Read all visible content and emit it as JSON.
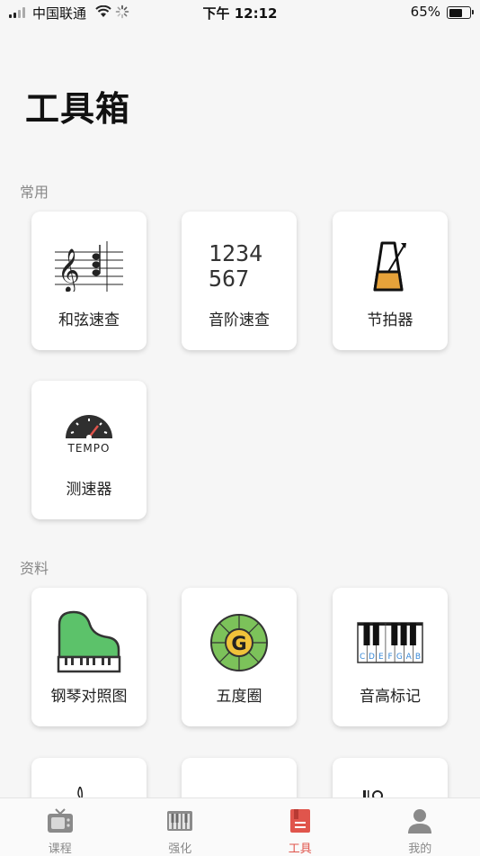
{
  "status_bar": {
    "carrier": "中国联通",
    "time": "下午 12:12",
    "battery_percent": "65%",
    "battery_level": 0.65
  },
  "page": {
    "title": "工具箱"
  },
  "sections": {
    "common": {
      "label": "常用",
      "items": [
        {
          "label": "和弦速查",
          "icon": "chord-staff-icon"
        },
        {
          "label": "音阶速查",
          "icon": "scale-numbers-icon",
          "icon_text_1": "1234",
          "icon_text_2": "567"
        },
        {
          "label": "节拍器",
          "icon": "metronome-icon"
        },
        {
          "label": "测速器",
          "icon": "tempo-meter-icon",
          "icon_text": "TEMPO"
        }
      ]
    },
    "reference": {
      "label": "资料",
      "items": [
        {
          "label": "钢琴对照图",
          "icon": "grand-piano-icon"
        },
        {
          "label": "五度圈",
          "icon": "circle-of-fifths-icon",
          "icon_text": "G"
        },
        {
          "label": "音高标记",
          "icon": "keyboard-notes-icon",
          "notes": [
            "C",
            "D",
            "E",
            "F",
            "G",
            "A",
            "B"
          ]
        }
      ]
    }
  },
  "tab_bar": {
    "tabs": [
      {
        "label": "课程",
        "icon": "tv-icon",
        "active": false
      },
      {
        "label": "强化",
        "icon": "piano-keys-icon",
        "active": false
      },
      {
        "label": "工具",
        "icon": "toolbox-icon",
        "active": true
      },
      {
        "label": "我的",
        "icon": "person-icon",
        "active": false
      }
    ]
  },
  "colors": {
    "accent": "#e0554c",
    "inactive": "#8a8a8a",
    "piano_green": "#5cc26a",
    "metronome_orange": "#e6a23a"
  }
}
